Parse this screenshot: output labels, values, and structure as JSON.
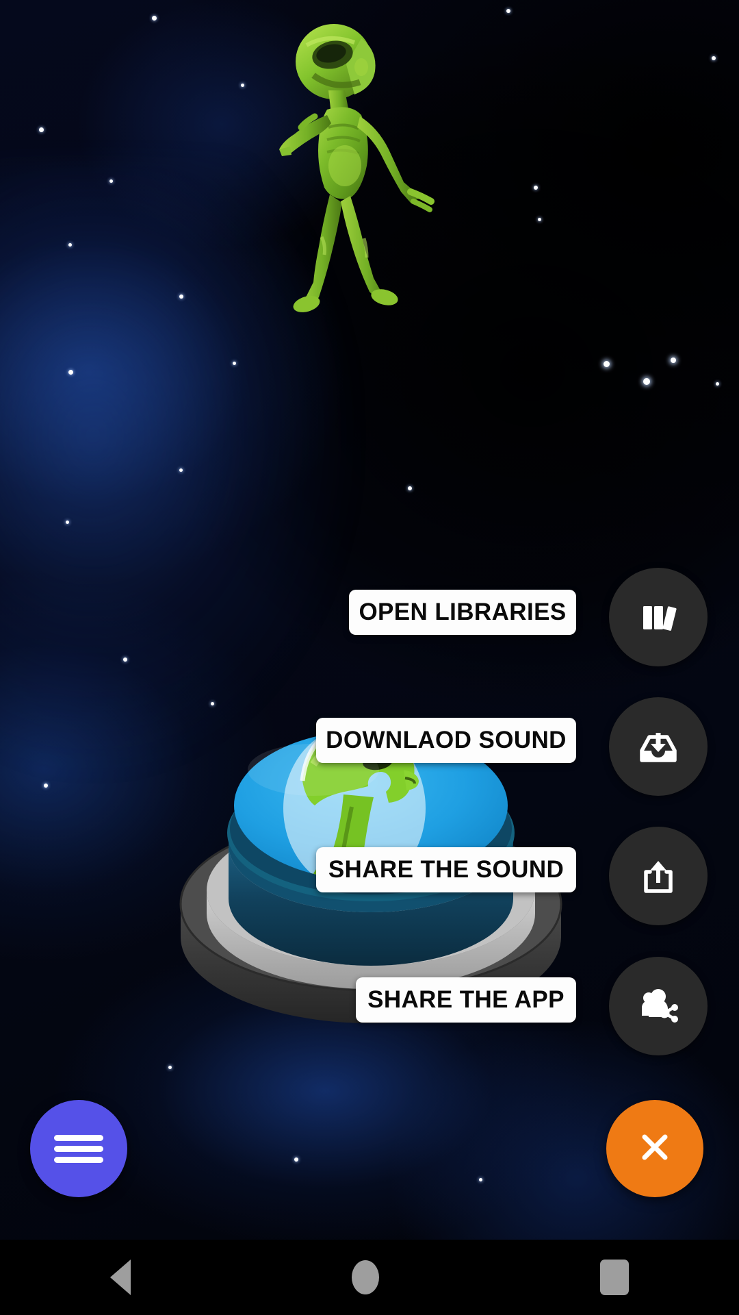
{
  "app": {
    "background_theme": "deep-space-nebula",
    "accent_menu_color": "#5551e8",
    "accent_close_color": "#ef7a14",
    "action_button_color": "#2a2a2a",
    "label_background_color": "#fdfdfd",
    "label_text_color": "#0a0a0a"
  },
  "hero": {
    "character_name": "dancing-alien",
    "body_color": "#8ec63f",
    "highlight_color": "#c7e85a",
    "shadow_color": "#4c7a18"
  },
  "sound_button": {
    "name": "alien-sound-button",
    "top_face_color": "#1c9ee0",
    "rim_color": "#104a6e",
    "mid_ring_color": "#b4b4b4",
    "base_color": "#3a3a3a",
    "character_color": "#7dc52a"
  },
  "menu": {
    "expanded": true,
    "items": [
      {
        "label": "OPEN LIBRARIES",
        "icon": "books-icon",
        "name": "open-libraries"
      },
      {
        "label": "DOWNLAOD SOUND",
        "icon": "download-tray-icon",
        "name": "download-sound"
      },
      {
        "label": "SHARE THE SOUND",
        "icon": "share-box-icon",
        "name": "share-the-sound"
      },
      {
        "label": "SHARE THE APP",
        "icon": "people-share-icon",
        "name": "share-the-app"
      }
    ]
  },
  "fabs": {
    "menu": {
      "icon": "hamburger-icon",
      "color": "#5551e8"
    },
    "close": {
      "icon": "close-icon",
      "glyph": "×",
      "color": "#ef7a14"
    }
  },
  "navbar": {
    "items": [
      {
        "label": "Back",
        "icon": "back-triangle-icon"
      },
      {
        "label": "Home",
        "icon": "home-circle-icon"
      },
      {
        "label": "Recents",
        "icon": "recents-square-icon"
      }
    ]
  }
}
